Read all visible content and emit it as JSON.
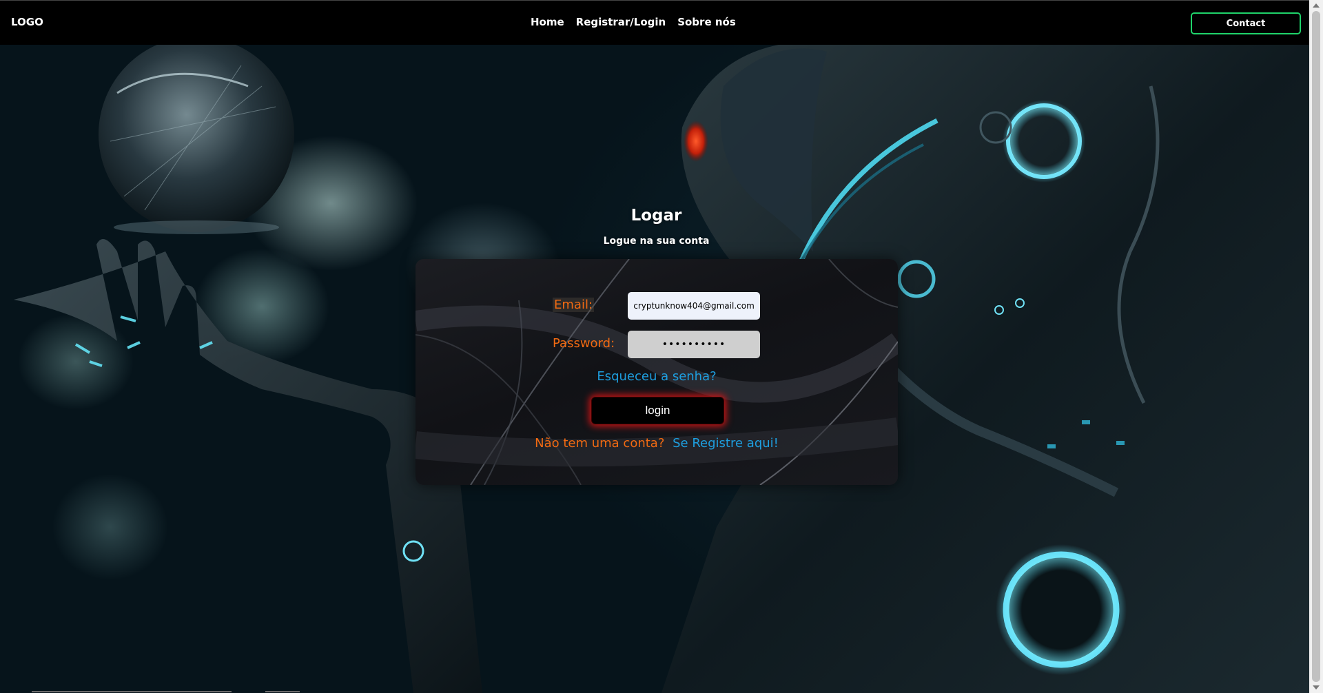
{
  "navbar": {
    "logo": "LOGO",
    "links": [
      {
        "label": "Home"
      },
      {
        "label": "Registrar/Login"
      },
      {
        "label": "Sobre nós"
      }
    ],
    "contact_label": "Contact"
  },
  "page": {
    "title": "Logar",
    "subtitle": "Logue na sua conta"
  },
  "form": {
    "email_label": "Email:",
    "email_value": "cryptunknow404@gmail.com",
    "password_label": "Password:",
    "password_value": "••••••••••",
    "forgot_label": "Esqueceu a senha?",
    "login_label": "login",
    "no_account_text": "Não tem uma conta?",
    "register_label": "Se Registre aqui!"
  },
  "colors": {
    "accent_green": "#1fd36a",
    "label_orange": "#f26a12",
    "link_blue": "#1e9fe0",
    "glow_red": "#e61414"
  }
}
